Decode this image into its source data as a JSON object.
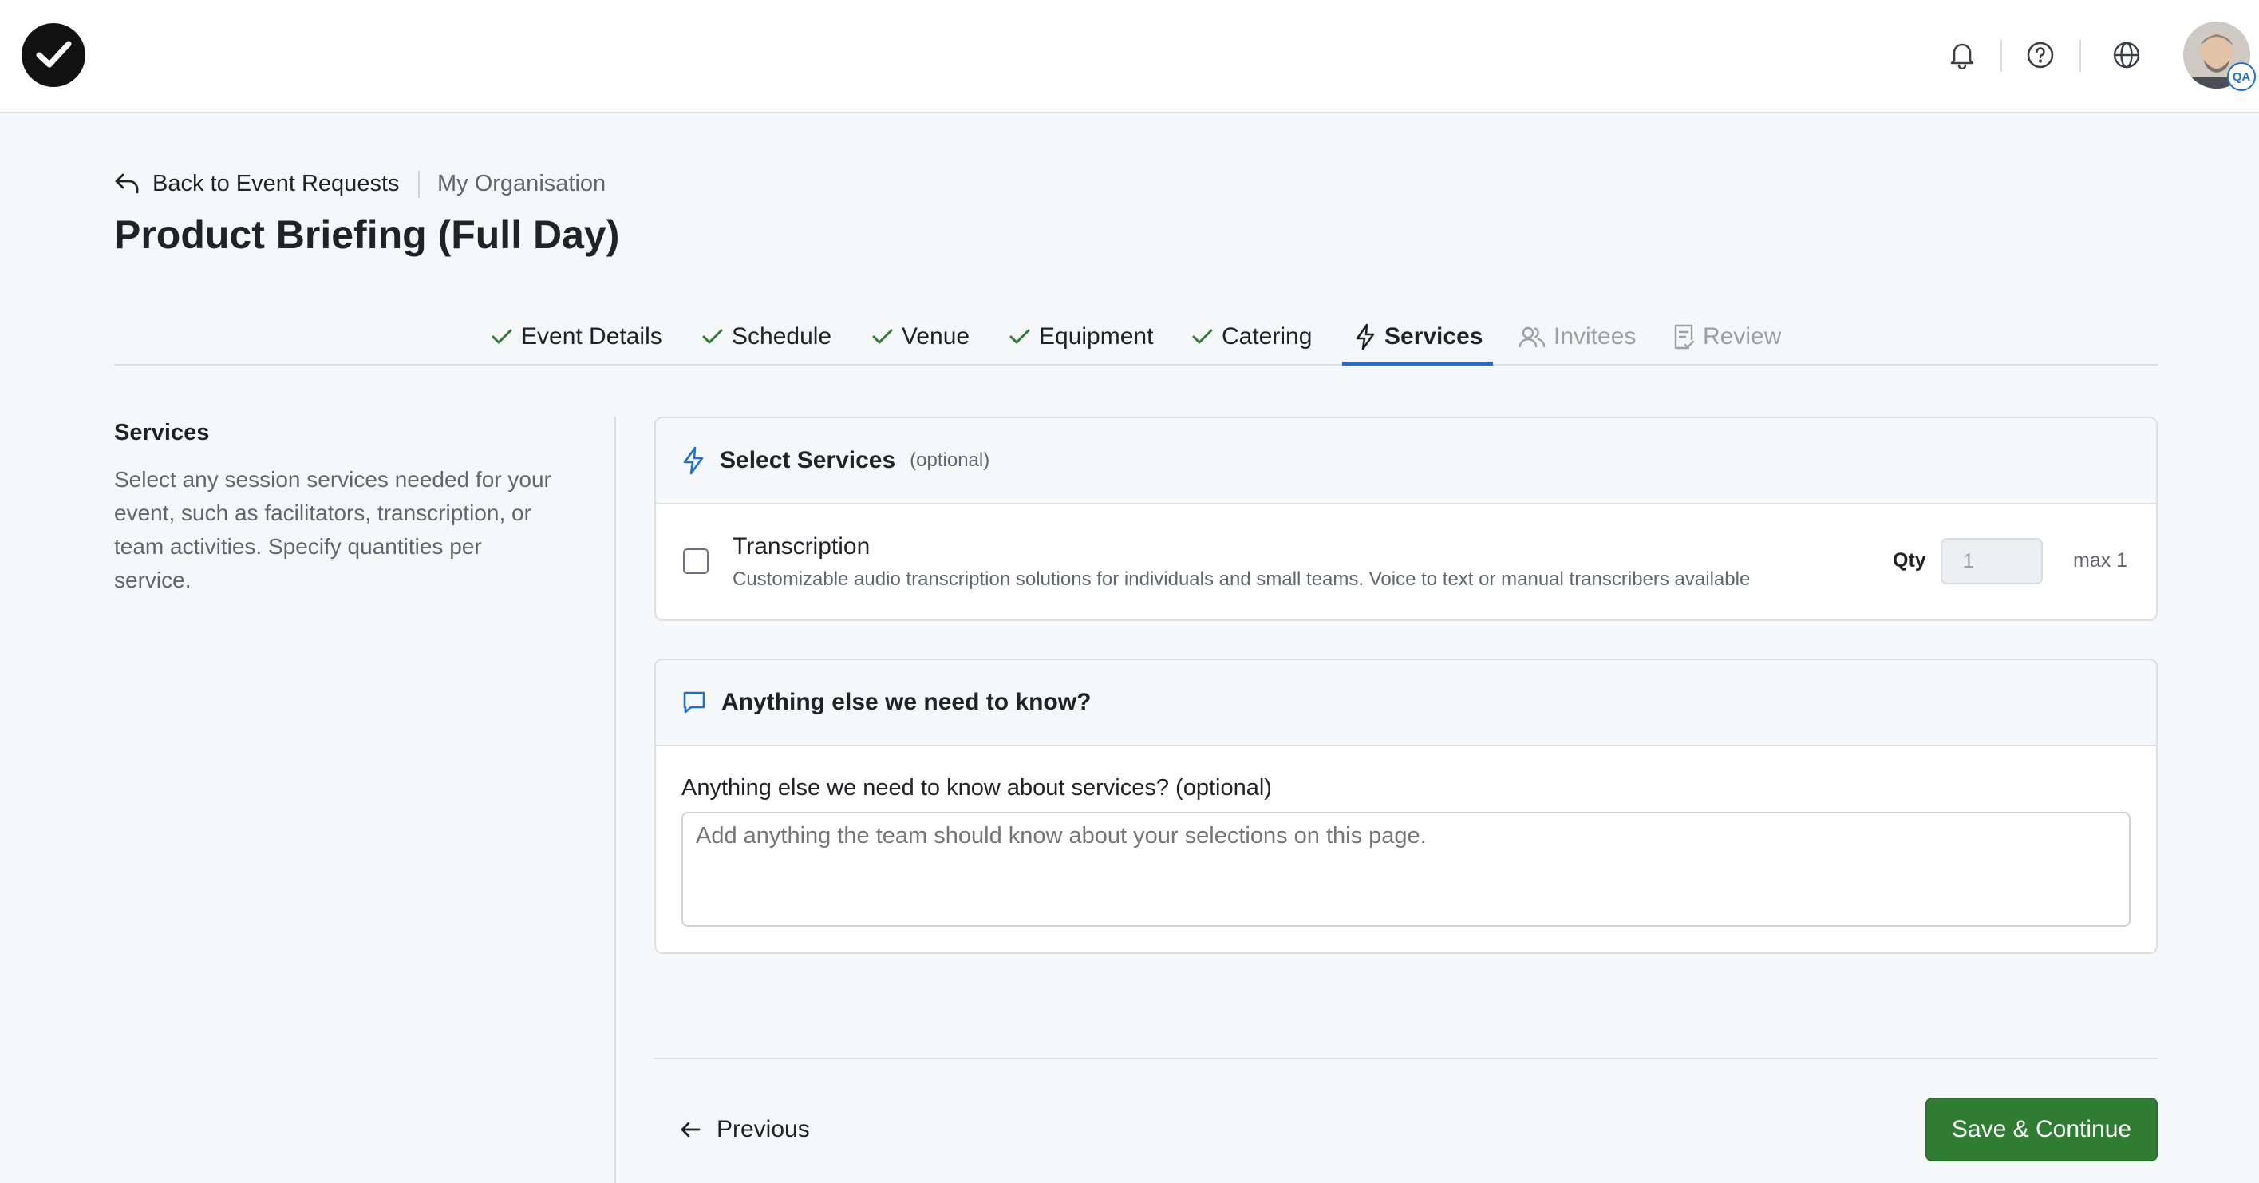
{
  "header": {
    "back_label": "Back to Event Requests",
    "organisation": "My Organisation",
    "title": "Product Briefing (Full Day)"
  },
  "topbar": {
    "icons": [
      "notification-bell-icon",
      "help-icon",
      "language-globe-icon"
    ],
    "avatar_badge": "QA"
  },
  "steps": [
    {
      "label": "Event Details",
      "state": "done"
    },
    {
      "label": "Schedule",
      "state": "done"
    },
    {
      "label": "Venue",
      "state": "done"
    },
    {
      "label": "Equipment",
      "state": "done"
    },
    {
      "label": "Catering",
      "state": "done"
    },
    {
      "label": "Services",
      "state": "active"
    },
    {
      "label": "Invitees",
      "state": "todo"
    },
    {
      "label": "Review",
      "state": "todo"
    }
  ],
  "sidebar": {
    "title": "Services",
    "description": "Select any session services needed for your event, such as facilitators, transcription, or team activities. Specify quantities per service."
  },
  "services_card": {
    "title": "Select Services",
    "optional": "(optional)",
    "items": [
      {
        "name": "Transcription",
        "description": "Customizable audio transcription solutions for individuals and small teams. Voice to text or manual transcribers available",
        "qty_label": "Qty",
        "qty_value": "1",
        "max_label": "max 1",
        "checked": false
      }
    ]
  },
  "notes_card": {
    "title": "Anything else we need to know?",
    "field_label": "Anything else we need to know about services? (optional)",
    "placeholder": "Add anything the team should know about your selections on this page."
  },
  "footer": {
    "previous_label": "Previous",
    "save_label": "Save & Continue"
  },
  "colors": {
    "accent_blue": "#1f6fd1",
    "success_green": "#2e7d32",
    "check_green": "#2e7d32"
  }
}
